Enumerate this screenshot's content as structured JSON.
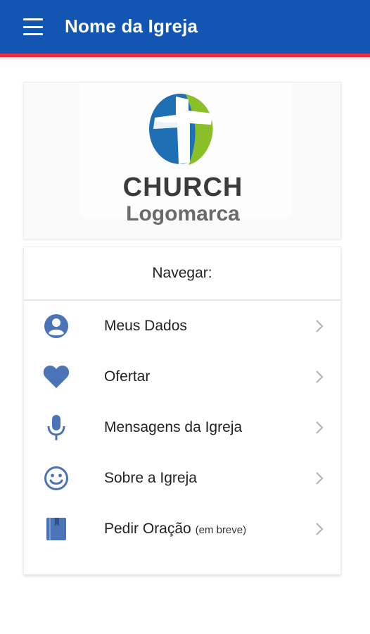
{
  "appbar": {
    "title": "Nome da Igreja",
    "colors": {
      "background": "#1355b2",
      "stripe": "#e8303c"
    }
  },
  "logo": {
    "line1": "CHURCH",
    "line2": "Logomarca",
    "colors": {
      "blue": "#1f6fb5",
      "green": "#8bbf2a"
    }
  },
  "nav": {
    "header": "Navegar:",
    "accent": "#4a73b8",
    "items": [
      {
        "label": "Meus Dados",
        "sub": "",
        "icon": "account-circle-icon"
      },
      {
        "label": "Ofertar",
        "sub": "",
        "icon": "heart-icon"
      },
      {
        "label": "Mensagens da Igreja",
        "sub": "",
        "icon": "microphone-icon"
      },
      {
        "label": "Sobre a Igreja",
        "sub": "",
        "icon": "smiley-face-icon"
      },
      {
        "label": "Pedir Oração",
        "sub": "(em breve)",
        "icon": "book-icon"
      }
    ]
  }
}
